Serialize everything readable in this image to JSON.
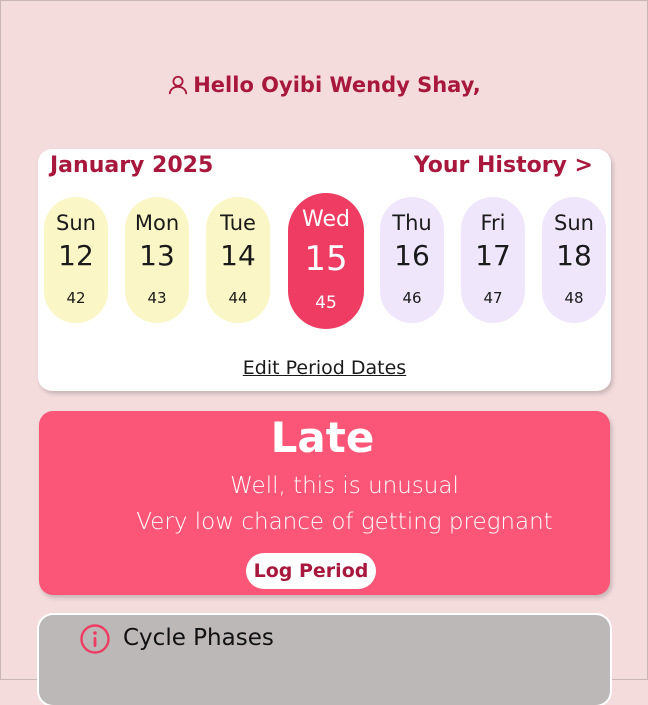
{
  "greeting": {
    "text": "Hello Oyibi Wendy Shay,"
  },
  "calendar": {
    "month": "January 2025",
    "history_link": "Your History >",
    "days": [
      {
        "name": "Sun",
        "date": "12",
        "cycle_day": "42",
        "state": "past"
      },
      {
        "name": "Mon",
        "date": "13",
        "cycle_day": "43",
        "state": "past"
      },
      {
        "name": "Tue",
        "date": "14",
        "cycle_day": "44",
        "state": "past"
      },
      {
        "name": "Wed",
        "date": "15",
        "cycle_day": "45",
        "state": "today"
      },
      {
        "name": "Thu",
        "date": "16",
        "cycle_day": "46",
        "state": "future"
      },
      {
        "name": "Fri",
        "date": "17",
        "cycle_day": "47",
        "state": "future"
      },
      {
        "name": "Sun",
        "date": "18",
        "cycle_day": "48",
        "state": "future"
      }
    ],
    "edit_link": "Edit Period Dates"
  },
  "status": {
    "title": "Late",
    "line1": "Well, this is unusual",
    "line2": "Very low chance of getting pregnant",
    "button": "Log Period"
  },
  "phases": {
    "title": "Cycle Phases",
    "icon": "info-icon"
  },
  "colors": {
    "accent": "#a8173c",
    "background": "#f4dcdd",
    "today": "#ee3c62",
    "status_card": "#fb5677",
    "past_day": "#fbf6c5",
    "future_day": "#efe6fb"
  }
}
